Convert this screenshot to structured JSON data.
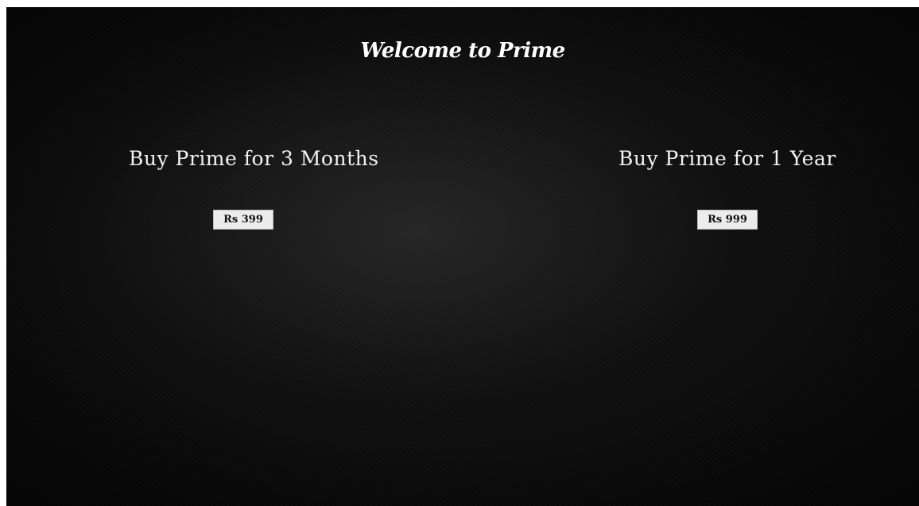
{
  "page": {
    "title": "Welcome to Prime"
  },
  "plans": {
    "three_months": {
      "heading": "Buy Prime for 3 Months",
      "button_label": "Rs 399"
    },
    "one_year": {
      "heading": "Buy Prime for 1 Year",
      "button_label": "Rs 999"
    }
  },
  "colors": {
    "background": "#0b0b0b",
    "text": "#ffffff",
    "button_bg": "#ececec",
    "button_text": "#111111"
  }
}
